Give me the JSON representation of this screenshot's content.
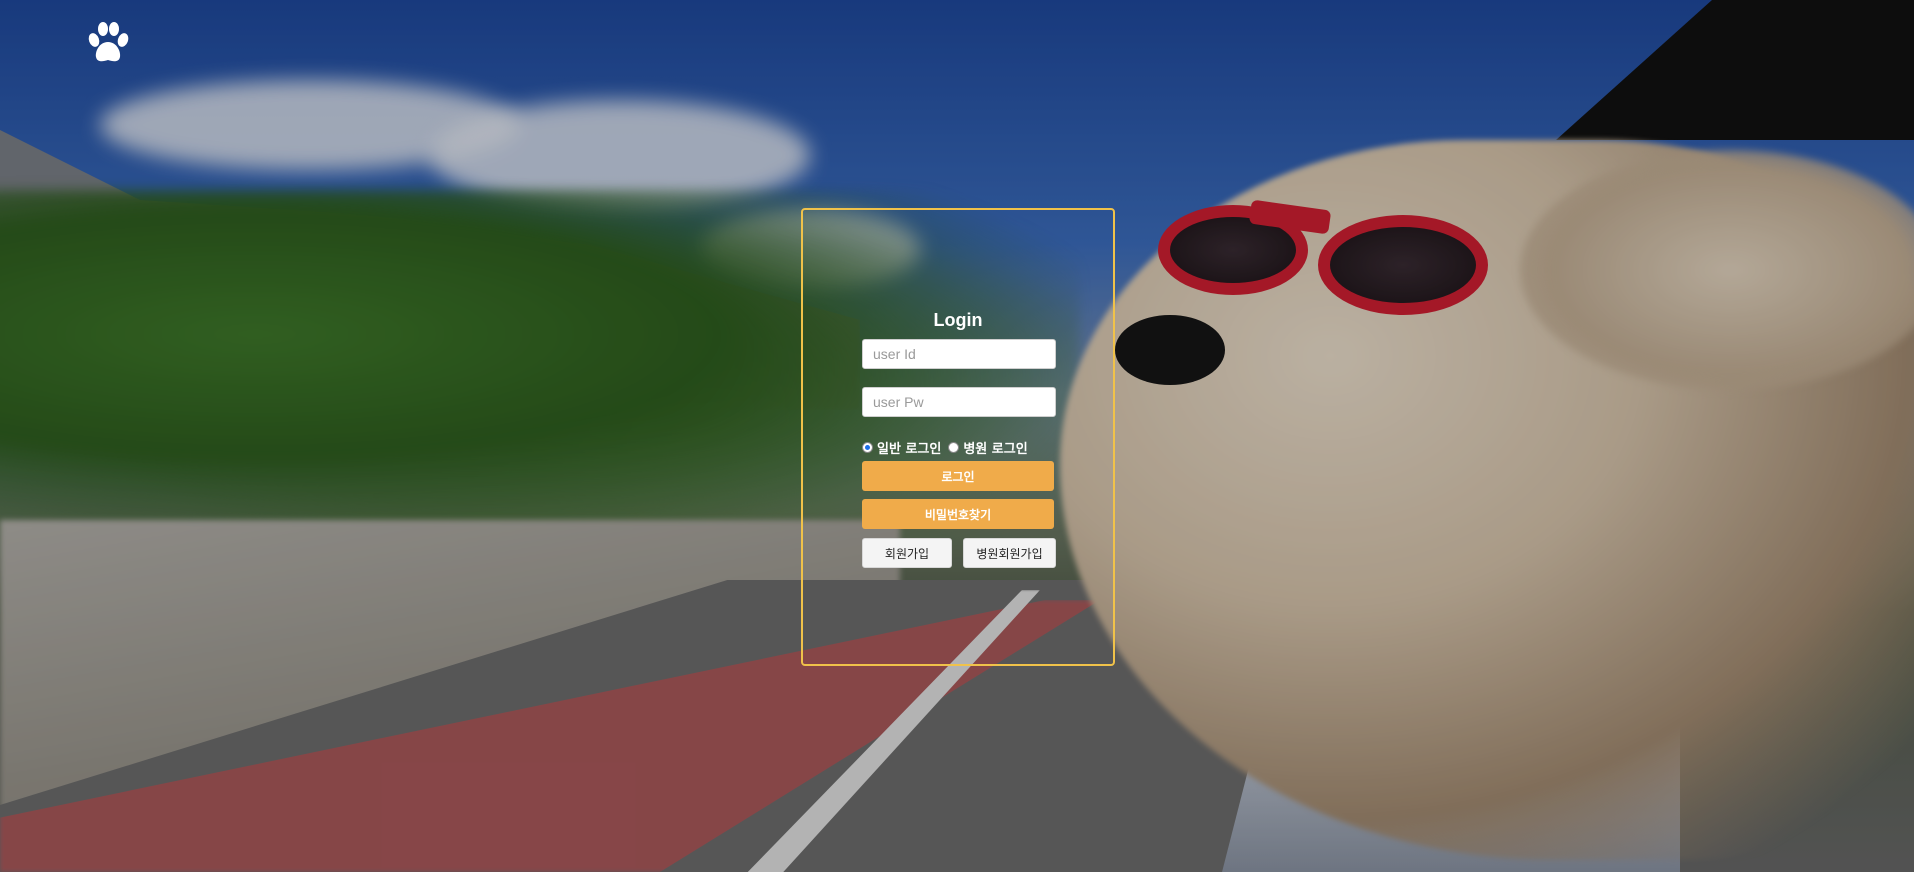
{
  "logo": {
    "icon": "paw-icon"
  },
  "login": {
    "title": "Login",
    "id_placeholder": "user Id",
    "pw_placeholder": "user Pw",
    "login_type_options": [
      "일반 로그인",
      "병원 로그인"
    ],
    "selected_login_type": "일반 로그인",
    "login_button": "로그인",
    "find_password_button": "비밀번호찾기",
    "signup_button": "회원가입",
    "hospital_signup_button": "병원회원가입"
  },
  "colors": {
    "panel_border": "#f0c24a",
    "primary_button": "#f0ab4a",
    "secondary_button": "#f4f4f4"
  }
}
